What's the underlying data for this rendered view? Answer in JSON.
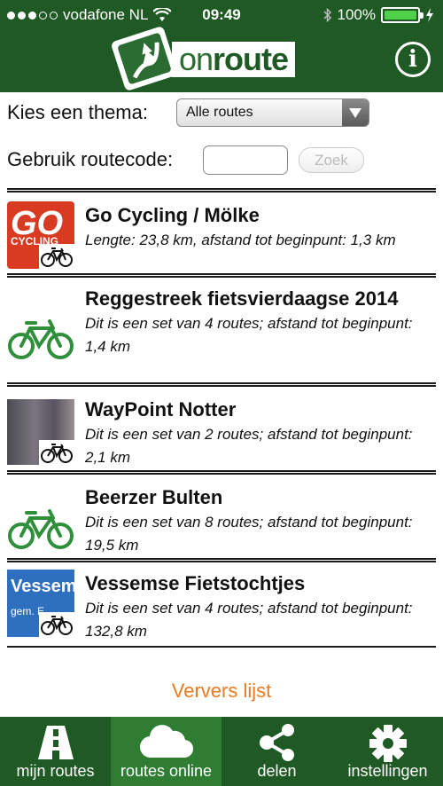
{
  "status_bar": {
    "carrier": "vodafone NL",
    "time": "09:49",
    "battery": "100%",
    "battery_level": 1.0
  },
  "header": {
    "logo_text_part1": "on",
    "logo_text_part2": "route",
    "info_icon": "info-circle-icon"
  },
  "filters": {
    "theme_label": "Kies een thema:",
    "theme_selected": "Alle routes",
    "routecode_label": "Gebruik routecode:",
    "routecode_value": "",
    "search_button": "Zoek"
  },
  "routes": [
    {
      "title": "Go Cycling / Mölke",
      "desc": "Lengte: 23,8 km, afstand tot beginpunt: 1,3 km",
      "thumb": "go-cycling-logo"
    },
    {
      "title": "Reggestreek fietsvierdaagse 2014",
      "desc": "Dit is een set van 4 routes; afstand tot beginpunt: 1,4 km",
      "thumb": "bicycle-icon"
    },
    {
      "title": "WayPoint Notter",
      "desc": "Dit is een set van 2 routes; afstand tot beginpunt: 2,1 km",
      "thumb": "photo"
    },
    {
      "title": "Beerzer Bulten",
      "desc": "Dit is een set van 8 routes; afstand tot beginpunt: 19,5 km",
      "thumb": "bicycle-icon"
    },
    {
      "title": "Vessemse Fietstochtjes",
      "desc": "Dit is een set van 4 routes; afstand tot beginpunt: 132,8 km",
      "thumb": "vessem-sign"
    }
  ],
  "thumb_text": {
    "go": "GO",
    "cycling": "CYCLING",
    "vessem": "Vessem",
    "vessem_sub": "gem. E"
  },
  "refresh_label": "Ververs lijst",
  "tabs": [
    {
      "label": "mijn routes",
      "icon": "road-icon",
      "active": false
    },
    {
      "label": "routes online",
      "icon": "cloud-icon",
      "active": true
    },
    {
      "label": "delen",
      "icon": "share-icon",
      "active": false
    },
    {
      "label": "instellingen",
      "icon": "gear-icon",
      "active": false
    }
  ],
  "colors": {
    "brand_green": "#1f5a25",
    "active_tab": "#2e7d32",
    "bike_green": "#2f8f3a",
    "refresh_orange": "#f07a1e"
  }
}
